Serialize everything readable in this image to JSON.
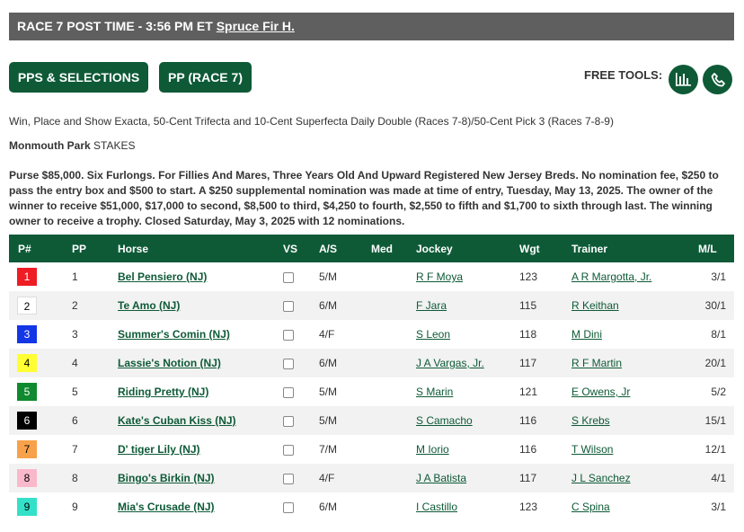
{
  "header": {
    "title": "RACE 7 POST TIME - 3:56 PM ET",
    "race_name": "Spruce Fir H."
  },
  "buttons": {
    "pps": "PPS & SELECTIONS",
    "pp": "PP (RACE 7)"
  },
  "free_tools": {
    "label": "FREE TOOLS:",
    "icons": [
      "chart-icon",
      "phone-icon"
    ]
  },
  "wagers": "Win, Place and Show Exacta, 50-Cent Trifecta and 10-Cent Superfecta Daily Double (Races 7-8)/50-Cent Pick 3 (Races 7-8-9)",
  "track": {
    "name": "Monmouth Park",
    "type": "STAKES"
  },
  "conditions": "Purse $85,000. Six Furlongs. For Fillies And Mares, Three Years Old And Upward Registered New Jersey Breds. No nomination fee, $250 to pass the entry box and $500 to start. A $250 supplemental nomination was made at time of entry, Tuesday, May 13, 2025. The owner of the winner to receive $51,000, $17,000 to second, $8,500 to third, $4,250 to fourth, $2,550 to fifth and $1,700 to sixth through last. The winning owner to receive a trophy. Closed Saturday, May 3, 2025 with 12 nominations.",
  "table": {
    "columns": [
      "P#",
      "PP",
      "Horse",
      "VS",
      "A/S",
      "Med",
      "Jockey",
      "Wgt",
      "Trainer",
      "M/L"
    ],
    "rows": [
      {
        "pnum": "1",
        "pp": "1",
        "horse": "Bel Pensiero (NJ)",
        "as": "5/M",
        "med": "",
        "jockey": "R F Moya",
        "wgt": "123",
        "trainer": "A R Margotta, Jr.",
        "ml": "3/1",
        "bg": "#ee1c25",
        "fg": "#ffffff"
      },
      {
        "pnum": "2",
        "pp": "2",
        "horse": "Te Amo (NJ)",
        "as": "6/M",
        "med": "",
        "jockey": "F Jara",
        "wgt": "115",
        "trainer": "R Keithan",
        "ml": "30/1",
        "bg": "#ffffff",
        "fg": "#000000"
      },
      {
        "pnum": "3",
        "pp": "3",
        "horse": "Summer's Comin (NJ)",
        "as": "4/F",
        "med": "",
        "jockey": "S Leon",
        "wgt": "118",
        "trainer": "M Dini",
        "ml": "8/1",
        "bg": "#1336e6",
        "fg": "#ffffff"
      },
      {
        "pnum": "4",
        "pp": "4",
        "horse": "Lassie's Notion (NJ)",
        "as": "6/M",
        "med": "",
        "jockey": "J A Vargas, Jr.",
        "wgt": "117",
        "trainer": "R F Martin",
        "ml": "20/1",
        "bg": "#ffff33",
        "fg": "#000000"
      },
      {
        "pnum": "5",
        "pp": "5",
        "horse": "Riding Pretty (NJ)",
        "as": "5/M",
        "med": "",
        "jockey": "S Marin",
        "wgt": "121",
        "trainer": "E Owens, Jr",
        "ml": "5/2",
        "bg": "#0f8a2e",
        "fg": "#ffffff"
      },
      {
        "pnum": "6",
        "pp": "6",
        "horse": "Kate's Cuban Kiss (NJ)",
        "as": "5/M",
        "med": "",
        "jockey": "S Camacho",
        "wgt": "116",
        "trainer": "S Krebs",
        "ml": "15/1",
        "bg": "#000000",
        "fg": "#ffffff"
      },
      {
        "pnum": "7",
        "pp": "7",
        "horse": "D' tiger Lily (NJ)",
        "as": "7/M",
        "med": "",
        "jockey": "M Iorio",
        "wgt": "116",
        "trainer": "T Wilson",
        "ml": "12/1",
        "bg": "#f7a24a",
        "fg": "#000000"
      },
      {
        "pnum": "8",
        "pp": "8",
        "horse": "Bingo's Birkin (NJ)",
        "as": "4/F",
        "med": "",
        "jockey": "J A Batista",
        "wgt": "117",
        "trainer": "J L Sanchez",
        "ml": "4/1",
        "bg": "#f9b9cb",
        "fg": "#000000"
      },
      {
        "pnum": "9",
        "pp": "9",
        "horse": "Mia's Crusade (NJ)",
        "as": "6/M",
        "med": "",
        "jockey": "I Castillo",
        "wgt": "123",
        "trainer": "C Spina",
        "ml": "3/1",
        "bg": "#33e0c8",
        "fg": "#000000"
      }
    ]
  }
}
